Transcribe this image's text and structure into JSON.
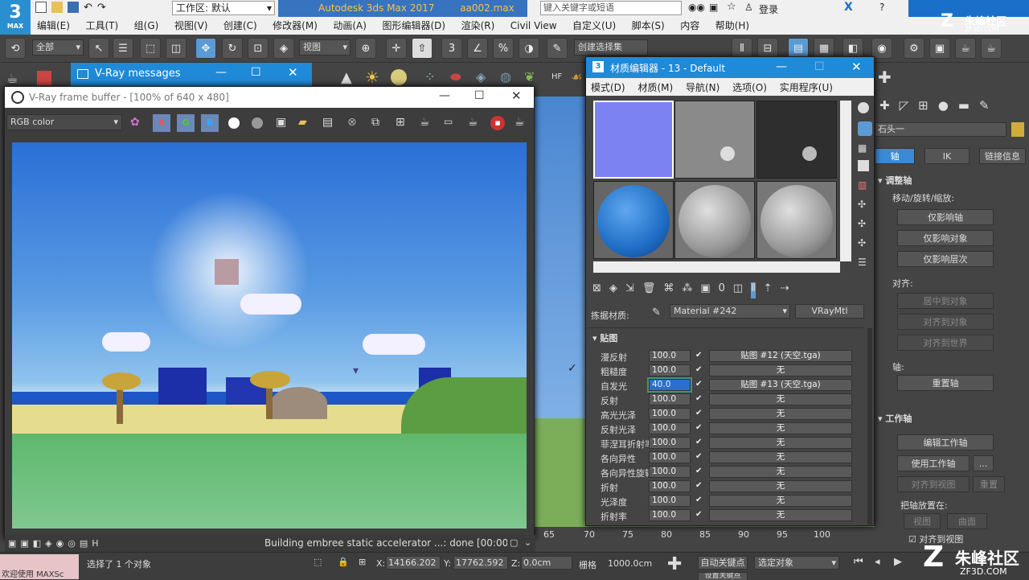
{
  "app": {
    "logo": "3",
    "logo_sub": "MAX",
    "workspace_label": "工作区: 默认",
    "title": "Autodesk 3ds Max 2017",
    "filename": "aa002.max",
    "search_placeholder": "键入关键字或短语",
    "login": "登录"
  },
  "menu": [
    "编辑(E)",
    "工具(T)",
    "组(G)",
    "视图(V)",
    "创建(C)",
    "修改器(M)",
    "动画(A)",
    "图形编辑器(D)",
    "渲染(R)",
    "Civil View",
    "自定义(U)",
    "脚本(S)",
    "内容",
    "帮助(H)"
  ],
  "toolbar": {
    "filter": "全部",
    "view": "视图",
    "selection_set": "创建选择集"
  },
  "vray_messages": {
    "title": "V-Ray messages"
  },
  "frame_buffer": {
    "title": "V-Ray frame buffer - [100% of 640 x 480]",
    "channel": "RGB color",
    "r": "R",
    "g": "G",
    "b": "B",
    "status": "Building embree static accelerator ...: done [00:00:0"
  },
  "material_editor": {
    "title": "材质编辑器 - 13 - Default",
    "menu": [
      "模式(D)",
      "材质(M)",
      "导航(N)",
      "选项(O)",
      "实用程序(U)"
    ],
    "pick_label": "拣据材质:",
    "material_name": "Material #242",
    "material_type": "VRayMtl",
    "rollout_title": "贴图",
    "rows": [
      {
        "label": "漫反射",
        "value": "100.0",
        "map": "贴图 #12 (天空.tga)"
      },
      {
        "label": "粗糙度",
        "value": "100.0",
        "map": "无"
      },
      {
        "label": "自发光",
        "value": "40.0",
        "map": "贴图 #13 (天空.tga)"
      },
      {
        "label": "反射",
        "value": "100.0",
        "map": "无"
      },
      {
        "label": "高光光泽",
        "value": "100.0",
        "map": "无"
      },
      {
        "label": "反射光泽",
        "value": "100.0",
        "map": "无"
      },
      {
        "label": "菲涅耳折射率",
        "value": "100.0",
        "map": "无"
      },
      {
        "label": "各向异性",
        "value": "100.0",
        "map": "无"
      },
      {
        "label": "各向异性旋转",
        "value": "100.0",
        "map": "无"
      },
      {
        "label": "折射",
        "value": "100.0",
        "map": "无"
      },
      {
        "label": "光泽度",
        "value": "100.0",
        "map": "无"
      },
      {
        "label": "折射率",
        "value": "100.0",
        "map": "无"
      }
    ]
  },
  "right_panel": {
    "object_name": "石头一",
    "tabs": [
      "轴",
      "IK",
      "链接信息"
    ],
    "adjust_pivot": "调整轴",
    "move_rotate_scale": "移动/旋转/缩放:",
    "affect_pivot": "仅影响轴",
    "affect_object": "仅影响对象",
    "affect_hierarchy": "仅影响层次",
    "align_label": "对齐:",
    "center_to_object": "居中到对象",
    "align_to_object": "对齐到对象",
    "align_to_world": "对齐到世界",
    "axis_label": "轴:",
    "reset_pivot": "重置轴",
    "working_pivot": "工作轴",
    "edit_working_pivot": "编辑工作轴",
    "use_working_pivot": "使用工作轴",
    "more": "...",
    "align_to_view": "对齐到视图",
    "reset": "重置",
    "place_pivot": "把轴放置在:",
    "view": "视图",
    "surface": "曲面",
    "align_to_view_chk": "对齐到视图"
  },
  "timeline": {
    "ticks": [
      "65",
      "70",
      "75",
      "80",
      "85",
      "90",
      "95",
      "100"
    ]
  },
  "status": {
    "welcome": "欢迎使用 MAXSc",
    "selected": "选择了 1 个对象",
    "x_label": "X:",
    "x_value": "14166.202",
    "y_label": "Y:",
    "y_value": "17762.592",
    "z_label": "Z:",
    "z_value": "0.0cm",
    "grid_label": "栅格",
    "grid_value": "1000.0cm",
    "auto_key": "自动关键点",
    "selected_obj": "选定对象",
    "set_key": "设置关键点"
  },
  "watermark": {
    "brand": "朱峰社区",
    "url": "ZF3D.COM"
  }
}
